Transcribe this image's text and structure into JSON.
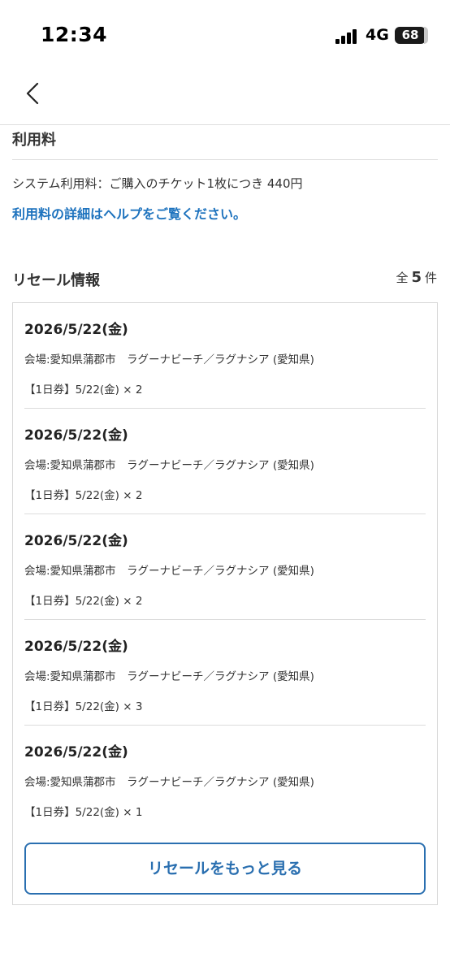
{
  "status_bar": {
    "time": "12:34",
    "network": "4G",
    "battery": "68"
  },
  "fees": {
    "heading": "利用料",
    "system_fee_text": "システム利用料：ご購入のチケット1枚につき 440円",
    "help_link": "利用料の詳細はヘルプをご覧ください。"
  },
  "resale": {
    "heading": "リセール情報",
    "count_prefix": "全",
    "count": "5",
    "count_suffix": "件",
    "items": [
      {
        "date": "2026/5/22(金)",
        "venue": "会場:愛知県蒲郡市　ラグーナビーチ／ラグナシア (愛知県)",
        "ticket": "【1日券】5/22(金) × 2"
      },
      {
        "date": "2026/5/22(金)",
        "venue": "会場:愛知県蒲郡市　ラグーナビーチ／ラグナシア (愛知県)",
        "ticket": "【1日券】5/22(金) × 2"
      },
      {
        "date": "2026/5/22(金)",
        "venue": "会場:愛知県蒲郡市　ラグーナビーチ／ラグナシア (愛知県)",
        "ticket": "【1日券】5/22(金) × 2"
      },
      {
        "date": "2026/5/22(金)",
        "venue": "会場:愛知県蒲郡市　ラグーナビーチ／ラグナシア (愛知県)",
        "ticket": "【1日券】5/22(金) × 3"
      },
      {
        "date": "2026/5/22(金)",
        "venue": "会場:愛知県蒲郡市　ラグーナビーチ／ラグナシア (愛知県)",
        "ticket": "【1日券】5/22(金) × 1"
      }
    ],
    "more_button": "リセールをもっと見る"
  },
  "colors": {
    "link": "#1e73be",
    "button_border": "#2a6fb0",
    "divider": "#dedede"
  },
  "icons": {
    "back": "chevron-left-icon",
    "signal": "cellular-signal-icon",
    "battery": "battery-icon"
  }
}
